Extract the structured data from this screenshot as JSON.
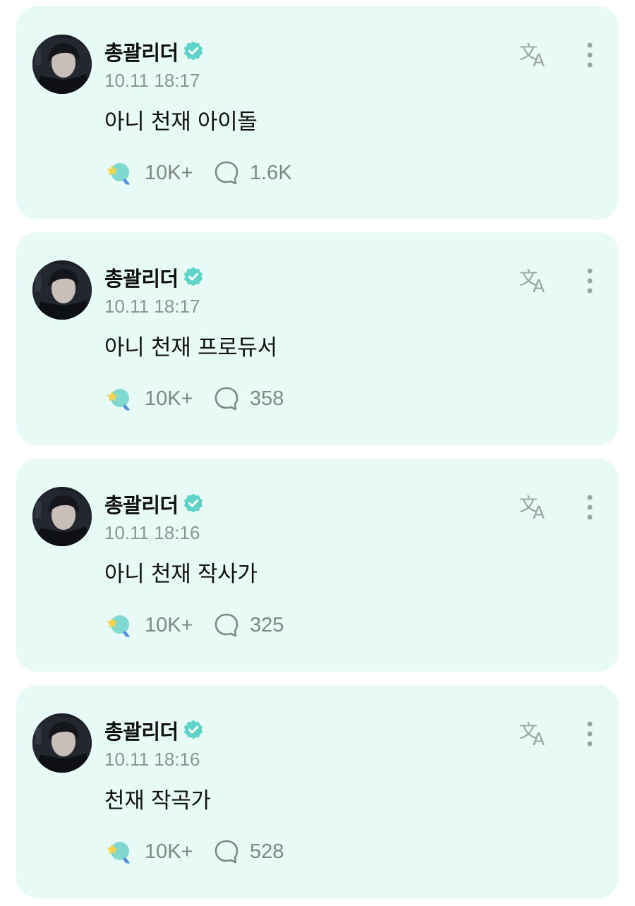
{
  "posts": [
    {
      "author": "총괄리더",
      "timestamp": "10.11 18:17",
      "content": "아니 천재 아이돌",
      "likes": "10K+",
      "comments": "1.6K"
    },
    {
      "author": "총괄리더",
      "timestamp": "10.11 18:17",
      "content": "아니 천재 프로듀서",
      "likes": "10K+",
      "comments": "358"
    },
    {
      "author": "총괄리더",
      "timestamp": "10.11 18:16",
      "content": "아니 천재 작사가",
      "likes": "10K+",
      "comments": "325"
    },
    {
      "author": "총괄리더",
      "timestamp": "10.11 18:16",
      "content": "천재 작곡가",
      "likes": "10K+",
      "comments": "528"
    }
  ],
  "icons": {
    "verified": "verified-badge-icon",
    "translate": "translate-icon",
    "more": "more-vertical-icon",
    "like": "star-bubble-like-icon",
    "comment": "comment-bubble-icon"
  },
  "colors": {
    "card_background": "#e8faf6",
    "verified_badge": "#5fd3c8",
    "muted_text": "#8d9593",
    "primary_text": "#111111"
  }
}
